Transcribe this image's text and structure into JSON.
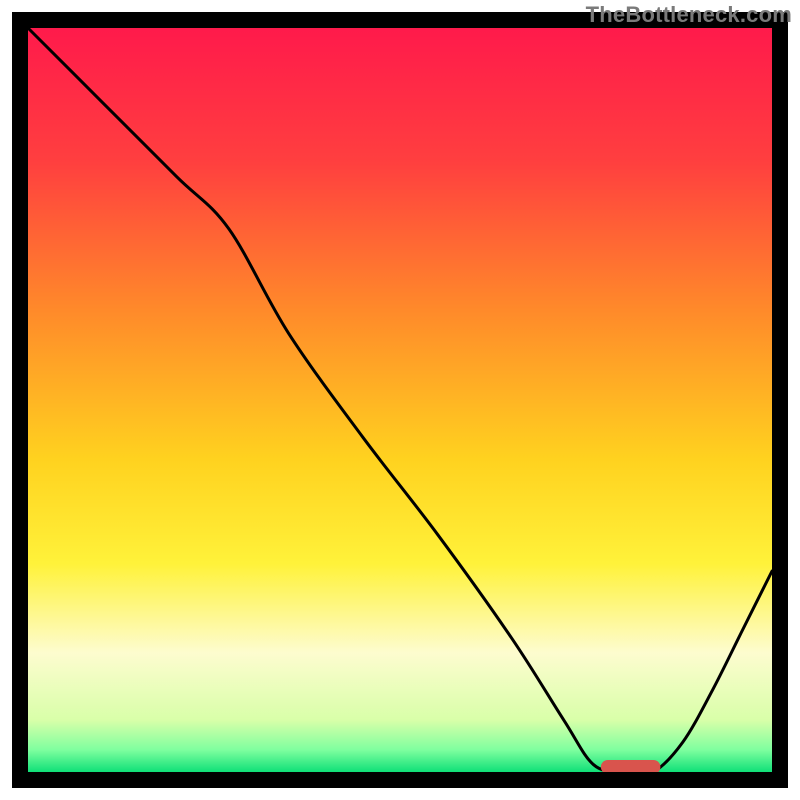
{
  "watermark": "TheBottleneck.com",
  "colors": {
    "frame": "#000000",
    "curve": "#000000",
    "marker_fill": "#d9544d",
    "gradient_stops": [
      {
        "offset": 0.0,
        "color": "#ff1a4b"
      },
      {
        "offset": 0.18,
        "color": "#ff3f3f"
      },
      {
        "offset": 0.38,
        "color": "#ff8a2a"
      },
      {
        "offset": 0.58,
        "color": "#ffd21f"
      },
      {
        "offset": 0.72,
        "color": "#fff23a"
      },
      {
        "offset": 0.84,
        "color": "#fdfccf"
      },
      {
        "offset": 0.93,
        "color": "#d9ffa9"
      },
      {
        "offset": 0.97,
        "color": "#7fff9f"
      },
      {
        "offset": 1.0,
        "color": "#10e078"
      }
    ]
  },
  "chart_data": {
    "type": "line",
    "title": "",
    "xlabel": "",
    "ylabel": "",
    "xlim": [
      0,
      100
    ],
    "ylim": [
      0,
      100
    ],
    "series": [
      {
        "name": "bottleneck-curve",
        "x": [
          0,
          10,
          20,
          27,
          35,
          45,
          55,
          65,
          72,
          76,
          80,
          84,
          88,
          92,
          96,
          100
        ],
        "y": [
          100,
          90,
          80,
          73,
          59,
          45,
          32,
          18,
          7,
          1,
          0,
          0,
          4,
          11,
          19,
          27
        ]
      }
    ],
    "marker": {
      "name": "optimal-range",
      "x_start": 77,
      "x_end": 85,
      "y": 0
    }
  }
}
